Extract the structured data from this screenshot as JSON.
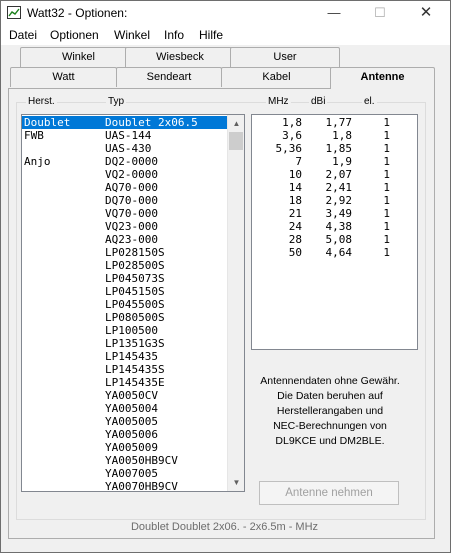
{
  "window": {
    "title": "Watt32 - Optionen:"
  },
  "titlebar": {
    "minimize": "—",
    "maximize": "☐",
    "close": "✕"
  },
  "menu": [
    "Datei",
    "Optionen",
    "Winkel",
    "Info",
    "Hilfe"
  ],
  "tabs_back": [
    "Winkel",
    "Wiesbeck",
    "User"
  ],
  "tabs_front": [
    "Watt",
    "Sendeart",
    "Kabel",
    "Antenne"
  ],
  "headers": {
    "manufacturer": "Herst.",
    "type": "Typ",
    "mhz": "MHz",
    "dbi": "dBi",
    "el": "el."
  },
  "antenna_list": [
    [
      "Doublet",
      "Doublet 2x06.5"
    ],
    [
      "FWB",
      "UAS-144"
    ],
    [
      "",
      "UAS-430"
    ],
    [
      "Anjo",
      "DQ2-0000"
    ],
    [
      "",
      "VQ2-0000"
    ],
    [
      "",
      "AQ70-000"
    ],
    [
      "",
      "DQ70-000"
    ],
    [
      "",
      "VQ70-000"
    ],
    [
      "",
      "VQ23-000"
    ],
    [
      "",
      "AQ23-000"
    ],
    [
      "",
      "LP028150S"
    ],
    [
      "",
      "LP028500S"
    ],
    [
      "",
      "LP045073S"
    ],
    [
      "",
      "LP045150S"
    ],
    [
      "",
      "LP045500S"
    ],
    [
      "",
      "LP080500S"
    ],
    [
      "",
      "LP100500"
    ],
    [
      "",
      "LP1351G3S"
    ],
    [
      "",
      "LP145435"
    ],
    [
      "",
      "LP145435S"
    ],
    [
      "",
      "LP145435E"
    ],
    [
      "",
      "YA0050CV"
    ],
    [
      "",
      "YA005004"
    ],
    [
      "",
      "YA005005"
    ],
    [
      "",
      "YA005006"
    ],
    [
      "",
      "YA005009"
    ],
    [
      "",
      "YA0050HB9CV"
    ],
    [
      "",
      "YA007005"
    ],
    [
      "",
      "YA0070HB9CV"
    ]
  ],
  "antenna_data": [
    [
      "1,8",
      "1,77",
      "1"
    ],
    [
      "3,6",
      "1,8",
      "1"
    ],
    [
      "5,36",
      "1,85",
      "1"
    ],
    [
      "7",
      "1,9",
      "1"
    ],
    [
      "10",
      "2,07",
      "1"
    ],
    [
      "14",
      "2,41",
      "1"
    ],
    [
      "18",
      "2,92",
      "1"
    ],
    [
      "21",
      "3,49",
      "1"
    ],
    [
      "24",
      "4,38",
      "1"
    ],
    [
      "28",
      "5,08",
      "1"
    ],
    [
      "50",
      "4,64",
      "1"
    ]
  ],
  "info_text": [
    "Antennendaten ohne Gewähr.",
    "Die Daten beruhen auf",
    "Herstellerangaben und",
    "NEC-Berechnungen von",
    "DL9KCE und DM2BLE."
  ],
  "button": {
    "take_antenna": "Antenne nehmen"
  },
  "status": "Doublet  Doublet 2x06.  -  2x6.5m  -   MHz",
  "colors": {
    "selection": "#0078d7",
    "background": "#f0f0f0"
  }
}
